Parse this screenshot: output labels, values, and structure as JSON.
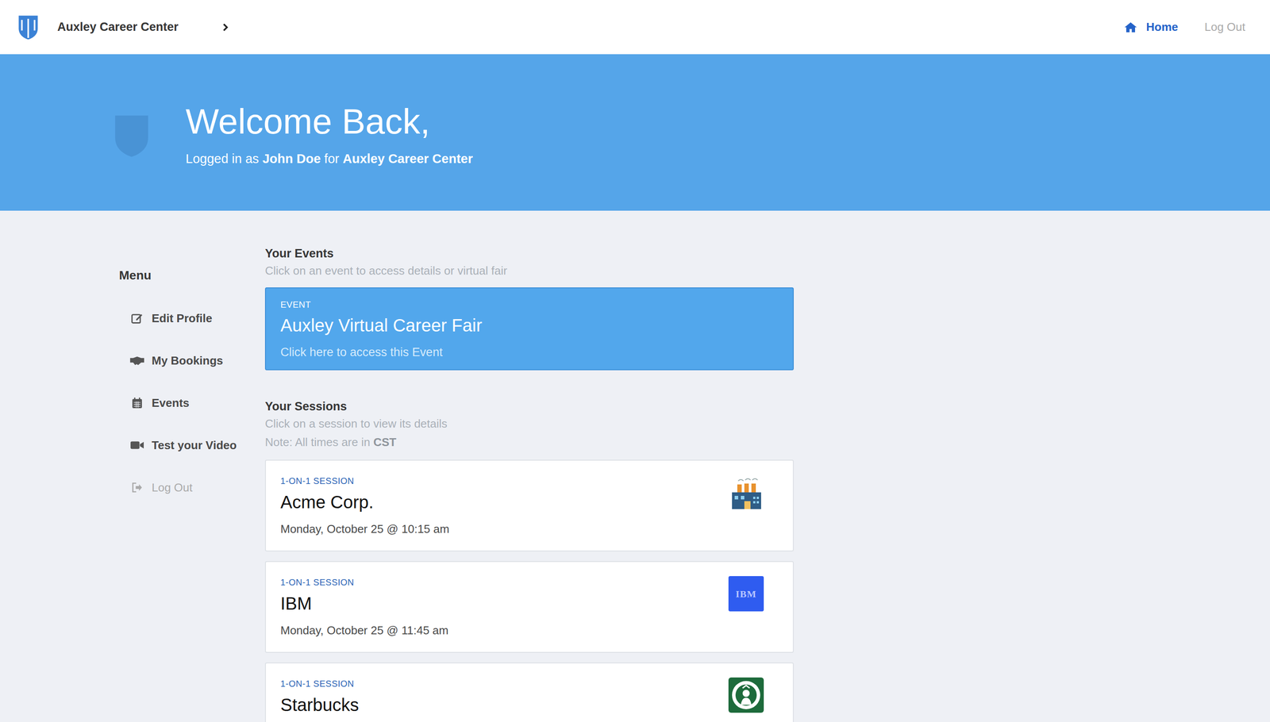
{
  "header": {
    "brand": "Auxley Career Center",
    "nav": [
      {
        "label": "Home",
        "selected": true
      },
      {
        "label": "Log Out",
        "selected": false
      }
    ]
  },
  "banner": {
    "title": "Welcome Back,",
    "prefix": "Logged in as ",
    "user": "John Doe",
    "middle": " for ",
    "org": "Auxley Career Center"
  },
  "menu": {
    "heading": "Menu",
    "items": [
      {
        "label": "Edit Profile",
        "kind": "edit",
        "disabled": false
      },
      {
        "label": "My Bookings",
        "kind": "bookings",
        "disabled": false
      },
      {
        "label": "Events",
        "kind": "calendar",
        "disabled": false
      },
      {
        "label": "Test your Video",
        "kind": "video",
        "disabled": false
      },
      {
        "label": "Log Out",
        "kind": "logout",
        "disabled": true
      }
    ]
  },
  "events": {
    "heading": "Your Events",
    "subtitle": "Click on an event to access details or virtual fair",
    "items": [
      {
        "tag": "EVENT",
        "title": "Auxley Virtual Career Fair",
        "action": "Click here to access this Event"
      }
    ]
  },
  "sessions": {
    "heading": "Your Sessions",
    "subtitle": "Click on a session to view its details",
    "note_prefix": "Note: All times are in ",
    "note_zone": "CST",
    "items": [
      {
        "tag": "1-ON-1 SESSION",
        "company": "Acme Corp.",
        "time": "Monday, October 25 @ 10:15 am",
        "kind": "factory"
      },
      {
        "tag": "1-ON-1 SESSION",
        "company": "IBM",
        "time": "Monday, October 25 @ 11:45 am",
        "kind": "ibm",
        "logo_text": "IBM"
      },
      {
        "tag": "1-ON-1 SESSION",
        "company": "Starbucks",
        "kind": "starbucks"
      }
    ]
  }
}
